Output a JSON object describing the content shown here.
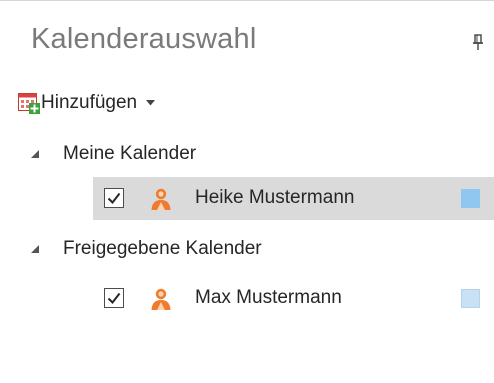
{
  "panel": {
    "title": "Kalenderauswahl",
    "pin_icon": "pin-icon"
  },
  "toolbar": {
    "add_label": "Hinzufügen",
    "add_icon": "calendar-add-icon",
    "dropdown_icon": "caret-down-icon"
  },
  "groups": [
    {
      "label": "Meine Kalender",
      "expanded": true,
      "calendars": [
        {
          "name": "Heike Mustermann",
          "checked": true,
          "selected": true,
          "icon": "person-icon",
          "color": "#8fc7f0"
        }
      ]
    },
    {
      "label": "Freigegebene Kalender",
      "expanded": true,
      "calendars": [
        {
          "name": "Max Mustermann",
          "checked": true,
          "selected": false,
          "icon": "person-icon",
          "color": "#c9e1f5"
        }
      ]
    }
  ],
  "colors": {
    "person_icon": "#f07a2e",
    "add_icon_plus": "#3aa33a"
  }
}
